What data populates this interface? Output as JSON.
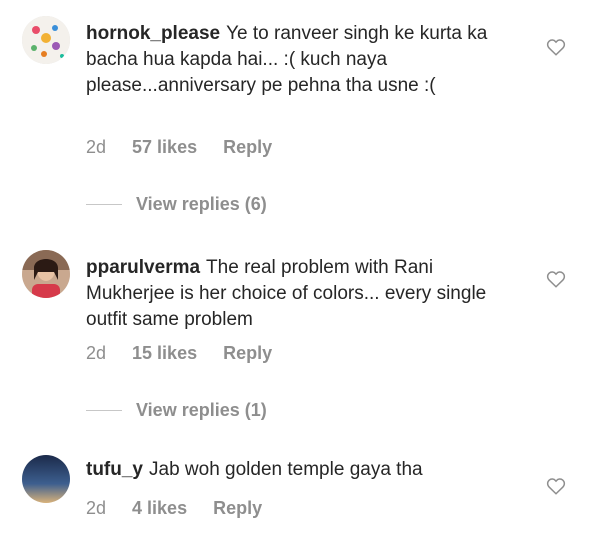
{
  "comments": [
    {
      "username": "hornok_please",
      "text": "Ye to ranveer singh ke kurta ka bacha hua kapda hai... :( kuch naya please...anniversary pe pehna tha usne :(",
      "age": "2d",
      "likes": "57 likes",
      "reply": "Reply",
      "view_replies": "View replies (6)"
    },
    {
      "username": "pparulverma",
      "text": "The real problem with Rani Mukherjee is her choice of colors... every single outfit same problem",
      "age": "2d",
      "likes": "15 likes",
      "reply": "Reply",
      "view_replies": "View replies (1)"
    },
    {
      "username": "tufu_y",
      "text": "Jab woh golden temple gaya tha",
      "age": "2d",
      "likes": "4 likes",
      "reply": "Reply"
    }
  ],
  "colors": {
    "text": "#262626",
    "muted": "#8e8e8e"
  },
  "icons": {
    "like": "heart-outline-icon"
  }
}
